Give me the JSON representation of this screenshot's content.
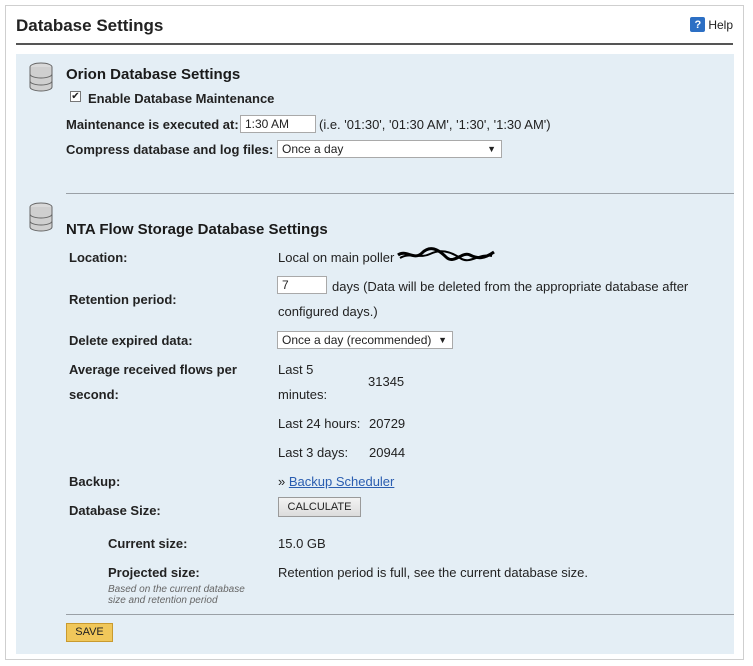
{
  "page": {
    "title": "Database Settings",
    "help_label": "Help"
  },
  "orion": {
    "title": "Orion Database Settings",
    "enable_label": "Enable Database Maintenance",
    "enable_checked": true,
    "maintenance_label": "Maintenance is executed at:",
    "maintenance_value": "1:30 AM",
    "maintenance_hint": "(i.e. '01:30', '01:30 AM', '1:30', '1:30 AM')",
    "compress_label": "Compress database and log files:",
    "compress_value": "Once a day"
  },
  "nta": {
    "title": "NTA Flow Storage Database Settings",
    "location_label": "Location:",
    "location_value": "Local on main poller",
    "retention_label": "Retention period:",
    "retention_value": "7",
    "retention_unit_line1": "days (Data will be deleted from the appropriate database after",
    "retention_unit_line2": "configured days.)",
    "delete_label": "Delete expired data:",
    "delete_value": "Once a day (recommended)",
    "avg_label_line1": "Average received flows per",
    "avg_label_line2": "second:",
    "flows": {
      "last5_line1": "Last 5",
      "last5_line2": "minutes:",
      "last5_value": "31345",
      "last24_label": "Last 24 hours:",
      "last24_value": "20729",
      "last3d_label": "Last 3 days:",
      "last3d_value": "20944"
    },
    "backup_label": "Backup:",
    "backup_prefix": "»",
    "backup_link": "Backup Scheduler",
    "dbsize_label": "Database Size:",
    "calculate_label": "CALCULATE",
    "current_size_label": "Current size:",
    "current_size_value": "15.0 GB",
    "projected_size_label": "Projected size:",
    "projected_size_value": "Retention period is full, see the current database size.",
    "projected_note_line1": "Based on the current database",
    "projected_note_line2": "size and retention period"
  },
  "actions": {
    "save_label": "SAVE"
  }
}
